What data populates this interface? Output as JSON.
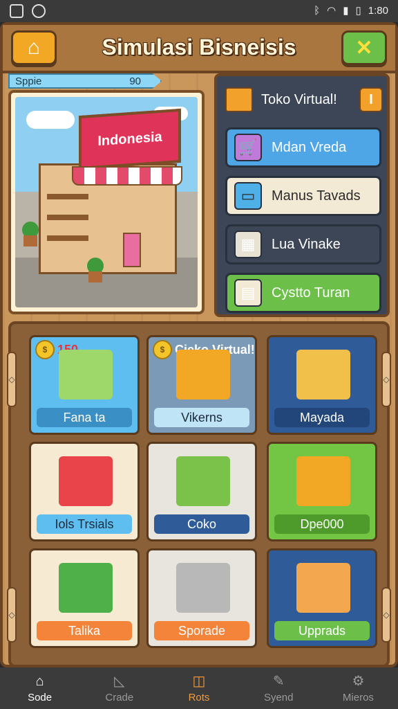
{
  "status_bar": {
    "time": "1:80"
  },
  "header": {
    "title": "Simulasi Bisneisis"
  },
  "progress": {
    "label": "Sppie",
    "value": "90"
  },
  "store": {
    "sign_text": "Indonesia"
  },
  "side_panel": {
    "title": "Toko Virtual!",
    "info_label": "I",
    "buttons": [
      {
        "label": "Mdan Vreda",
        "color": "#4fa6e6",
        "text_color": "#ffffff"
      },
      {
        "label": "Manus Tavads",
        "color": "#f3ead6",
        "text_color": "#2b2b2b"
      },
      {
        "label": "Lua Vinake",
        "color": "#3c4656",
        "text_color": "#ffffff"
      },
      {
        "label": "Cystto Turan",
        "color": "#6cc04a",
        "text_color": "#ffffff"
      }
    ]
  },
  "grid": {
    "tiles": [
      {
        "caption": "Fana ta",
        "badge": "150",
        "bg": "#5fbef0"
      },
      {
        "caption": "Vikerns",
        "badge": "Cieko Virtual!",
        "bg": "#7a9ab8"
      },
      {
        "caption": "Mayada",
        "badge": "",
        "bg": "#2f5c98"
      },
      {
        "caption": "Iols Trsials",
        "badge": "",
        "bg": "#f6ead2"
      },
      {
        "caption": "Coko",
        "badge": "",
        "bg": "#e8e4de"
      },
      {
        "caption": "Dpe000",
        "badge": "",
        "bg": "#73c544"
      },
      {
        "caption": "Talika",
        "badge": "",
        "bg": "#f6ead2"
      },
      {
        "caption": "Sporade",
        "badge": "",
        "bg": "#e8e4de"
      },
      {
        "caption": "Upprads",
        "badge": "",
        "bg": "#2f5c98"
      }
    ]
  },
  "nav": {
    "items": [
      {
        "label": "Sode",
        "icon": "home-icon"
      },
      {
        "label": "Crade",
        "icon": "shoe-icon"
      },
      {
        "label": "Rots",
        "icon": "bag-icon"
      },
      {
        "label": "Syend",
        "icon": "wrench-icon"
      },
      {
        "label": "Mieros",
        "icon": "gear-icon"
      }
    ]
  }
}
